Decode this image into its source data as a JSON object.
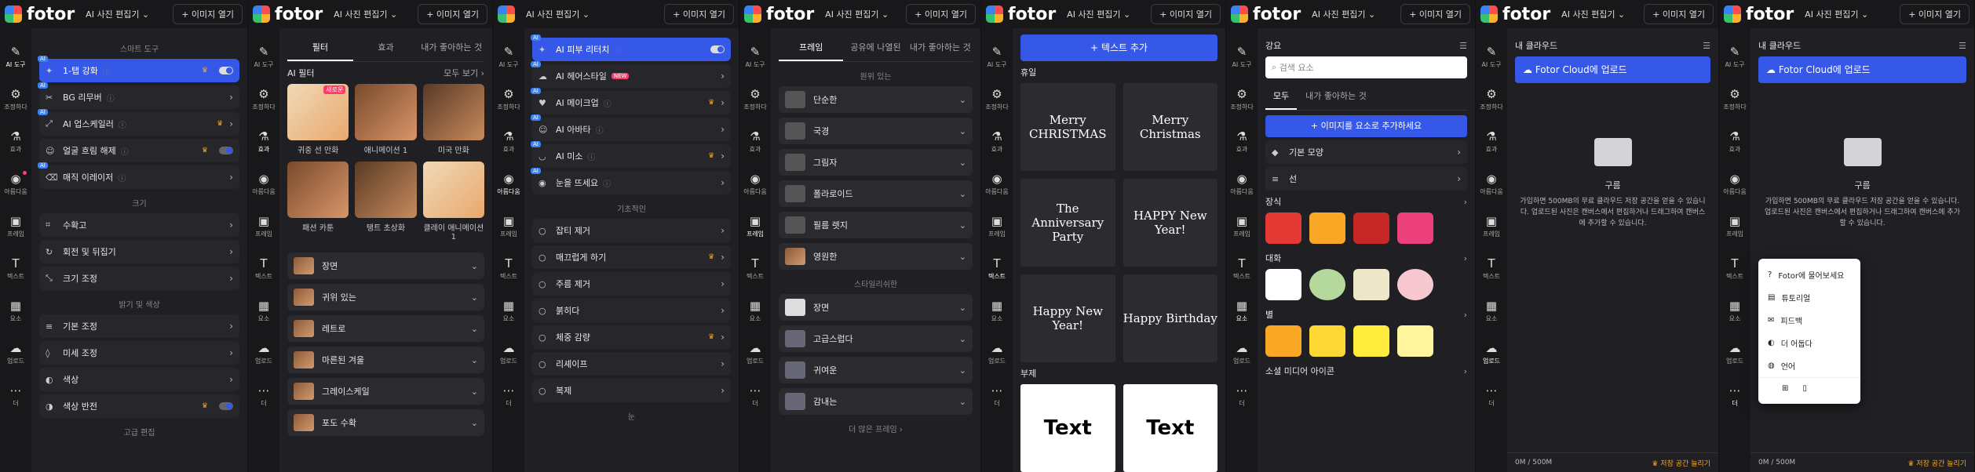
{
  "topbar": {
    "brand": "fotor",
    "menu": "AI 사진 편집기 ⌄",
    "open_image": "+ 이미지 열기"
  },
  "rail": [
    {
      "icon": "✎",
      "label": "AI 도구"
    },
    {
      "icon": "⚙",
      "label": "조정하다"
    },
    {
      "icon": "⚗",
      "label": "효과"
    },
    {
      "icon": "◉",
      "label": "아름다움"
    },
    {
      "icon": "▣",
      "label": "프레임"
    },
    {
      "icon": "T",
      "label": "텍스트"
    },
    {
      "icon": "▦",
      "label": "요소"
    },
    {
      "icon": "☁",
      "label": "업로드"
    },
    {
      "icon": "⋯",
      "label": "더"
    }
  ],
  "p1": {
    "title": "스마트 도구",
    "tools": [
      {
        "label": "1-탭 강화",
        "info": "ⓘ",
        "ai": "AI",
        "badge": ""
      },
      {
        "label": "BG 리무버",
        "info": "ⓘ",
        "ai": "AI",
        "badge": ""
      },
      {
        "label": "AI 업스케일러",
        "info": "ⓘ",
        "ai": "AI",
        "badge": ""
      },
      {
        "label": "얼굴 흐림 해제",
        "info": "ⓘ",
        "ai": "",
        "badge": ""
      },
      {
        "label": "매직 이레이저",
        "info": "ⓘ",
        "ai": "AI",
        "badge": ""
      }
    ],
    "size_title": "크기",
    "size": [
      "수확고",
      "회전 및 뒤집기",
      "크기 조정"
    ],
    "light_title": "밝기 및 색상",
    "light": [
      "기본 조정",
      "미세 조정",
      "색상",
      "색상 반전"
    ],
    "adv_title": "고급 편집"
  },
  "p2": {
    "tabs": [
      "필터",
      "효과",
      "내가 좋아하는 것"
    ],
    "ai_title": "AI 필터",
    "more": "모두 보기 ›",
    "hot": "새로운",
    "filters": [
      "귀중 선 만화",
      "애니메이션 1",
      "미국 만화",
      "패션 카툰",
      "탱트 초상화",
      "클레이 애니메이션 1"
    ],
    "cats": [
      "장면",
      "귀위 있는",
      "레트로",
      "마른된 겨울",
      "그레이스케일",
      "포도 수확"
    ]
  },
  "p3": {
    "ai": [
      {
        "label": "AI 피부 리터치",
        "new": ""
      },
      {
        "label": "AI 헤어스타일",
        "new": "NEW"
      },
      {
        "label": "AI 메이크업",
        "new": ""
      },
      {
        "label": "AI 아바타",
        "new": ""
      },
      {
        "label": "AI 미소",
        "new": ""
      },
      {
        "label": "눈을 뜨세요",
        "new": ""
      }
    ],
    "basic_title": "기초적인",
    "basic": [
      "잡티 제거",
      "매끄럽게 하기",
      "주름 제거",
      "붉히다",
      "체중 감량",
      "리셰이프",
      "복제"
    ],
    "more": "눈"
  },
  "p4": {
    "tabs": [
      "프레임",
      "공유에 나열된",
      "내가 좋아하는 것"
    ],
    "sec1": "원위 있는",
    "frames": [
      "단순한",
      "국경",
      "그림자",
      "폴라로이드",
      "필름 렛지",
      "영원한"
    ],
    "sec2": "스타일리쉬한",
    "frames2": [
      "장면",
      "고급스럽다",
      "귀여운",
      "감내는"
    ],
    "more": "더 많은 프레임 ›"
  },
  "p5": {
    "add_text": "+ 텍스트 추가",
    "holiday": "휴일",
    "sub": "부제",
    "cards": [
      "Merry CHRISTMAS",
      "Merry Christmas",
      "The Anniversary Party",
      "HAPPY New Year!",
      "Happy New Year!",
      "Happy Birthday"
    ],
    "sub_cards": [
      "Text",
      "Text"
    ]
  },
  "p6": {
    "title": "강요",
    "search": "검색 요소",
    "tabs": [
      "모두",
      "내가 좋아하는 것"
    ],
    "add": "+ 이미지를 요소로 추가하세요",
    "shapes": [
      "기본 모양",
      "선"
    ],
    "decor": "장식",
    "dialog": "대화",
    "star": "별",
    "social": "소셜 미디어 아이콘"
  },
  "p7": {
    "title": "내 클라우드",
    "upload": "Fotor Cloud에 업로드",
    "empty": "구름",
    "desc": "가입하면 500MB의 무료 클라우드 저장 공간을 얻을 수 있습니다. 업로드된 사진은 캔버스에서 편집하거나 드래그하여 캔버스에 추가할 수 있습니다.",
    "quota": "0M / 500M",
    "upgrade": "♛ 저장 공간 늘리기"
  },
  "p8": {
    "title": "내 클라우드",
    "upload": "Fotor Cloud에 업로드",
    "empty": "구름",
    "desc": "가입하면 500MB의 무료 클라우드 저장 공간을 얻을 수 있습니다. 업로드된 사진은 캔버스에서 편집하거나 드래그하여 캔버스에 추가할 수 있습니다.",
    "menu": [
      "Fotor에 물어보세요",
      "튜토리얼",
      "피드백",
      "더 어둡다",
      "언어"
    ],
    "quota": "0M / 500M",
    "upgrade": "♛ 저장 공간 늘리기"
  }
}
